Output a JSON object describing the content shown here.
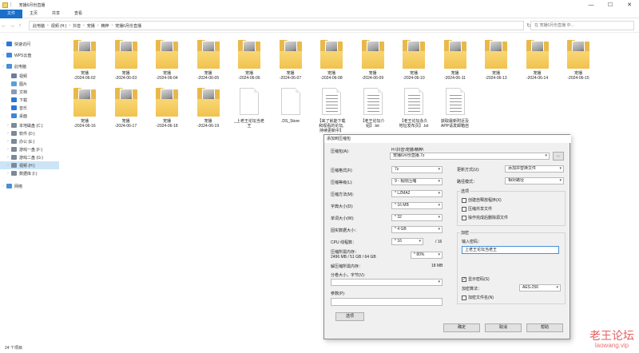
{
  "window": {
    "title": "宠播6月份直播",
    "minimize": "—",
    "maximize": "☐",
    "close": "✕"
  },
  "ribbon": {
    "tabs": [
      "文件",
      "主页",
      "共享",
      "查看"
    ]
  },
  "address": {
    "crumbs": [
      "此电脑",
      "视频 (H:)",
      "抖音",
      "宠播",
      "精粹",
      "宠播6月份直播"
    ],
    "search_placeholder": "在 宠播6月份直播 中..."
  },
  "sidebar": {
    "items": [
      {
        "label": "快速访问",
        "icon": "star-icon",
        "color": "#2b78d4"
      },
      {
        "label": "WPS云盘",
        "icon": "cloud-icon",
        "color": "#3a86e0"
      },
      {
        "label": "此电脑",
        "icon": "computer-icon",
        "color": "#4a8fd8"
      },
      {
        "label": "视频",
        "icon": "video-folder-icon",
        "color": "#6a7f99"
      },
      {
        "label": "图片",
        "icon": "pictures-icon",
        "color": "#5aa0d8"
      },
      {
        "label": "文档",
        "icon": "documents-icon",
        "color": "#8a9bb0"
      },
      {
        "label": "下载",
        "icon": "download-icon",
        "color": "#2b78d4"
      },
      {
        "label": "音乐",
        "icon": "music-icon",
        "color": "#2b78d4"
      },
      {
        "label": "桌面",
        "icon": "desktop-icon",
        "color": "#3a86e0"
      },
      {
        "label": "本地磁盘 (C:)",
        "icon": "drive-icon",
        "color": "#7a8a9a"
      },
      {
        "label": "软件 (D:)",
        "icon": "drive-icon",
        "color": "#7a8a9a"
      },
      {
        "label": "办公 (E:)",
        "icon": "drive-icon",
        "color": "#7a8a9a"
      },
      {
        "label": "游戏一盘 (F:)",
        "icon": "drive-icon",
        "color": "#7a8a9a"
      },
      {
        "label": "游戏二盘 (G:)",
        "icon": "drive-icon",
        "color": "#7a8a9a"
      },
      {
        "label": "视频 (H:)",
        "icon": "drive-icon",
        "color": "#7a8a9a"
      },
      {
        "label": "数据库 (I:)",
        "icon": "drive-icon",
        "color": "#7a8a9a"
      },
      {
        "label": "网络",
        "icon": "network-icon",
        "color": "#4a8fd8"
      }
    ]
  },
  "files": [
    {
      "name": "宠播\n-2024-06-02",
      "type": "folder"
    },
    {
      "name": "宠播\n-2024-06-03",
      "type": "folder"
    },
    {
      "name": "宠播\n-2024-06-04",
      "type": "folder"
    },
    {
      "name": "宠播\n-2024-06-05",
      "type": "folder"
    },
    {
      "name": "宠播\n-2024-06-06",
      "type": "folder"
    },
    {
      "name": "宠播\n-2024-06-07",
      "type": "folder"
    },
    {
      "name": "宠播\n-2024-06-08",
      "type": "folder"
    },
    {
      "name": "宠播\n-2024-06-09",
      "type": "folder"
    },
    {
      "name": "宠播\n-2024-06-10",
      "type": "folder"
    },
    {
      "name": "宠播\n-2024-06-11",
      "type": "folder"
    },
    {
      "name": "宠播\n-2024-06-13",
      "type": "folder"
    },
    {
      "name": "宠播\n-2024-06-14",
      "type": "folder"
    },
    {
      "name": "宠播\n-2024-06-15",
      "type": "folder"
    },
    {
      "name": "宠播\n-2024-06-16",
      "type": "folder"
    },
    {
      "name": "宠播\n-2024-06-17",
      "type": "folder"
    },
    {
      "name": "宠播\n-2024-06-18",
      "type": "folder"
    },
    {
      "name": "宠播\n-2024-06-19",
      "type": "folder"
    },
    {
      "name": "_上老王论坛当老\n王",
      "type": "doc"
    },
    {
      "name": ".DS_Store",
      "type": "doc"
    },
    {
      "name": "【来了就能下载\n和观看的论坛,\n持续更新中】",
      "type": "doc"
    },
    {
      "name": "【老王论坛介\n绍】.txt",
      "type": "doc"
    },
    {
      "name": "【老王论坛永久\n地址发布页】.txt",
      "type": "doc"
    },
    {
      "name": "获取最新附近及\nAPP请发邮箱自",
      "type": "doc"
    }
  ],
  "status": {
    "count_text": "24 个项目"
  },
  "dialog": {
    "title": "添加到压缩包",
    "archive_label": "压缩包(A):",
    "archive_path": "H:\\抖音\\宠播\\精粹\\",
    "archive_name": "宠播6月份直播.7z",
    "browse_label": "...",
    "format_label": "压缩格式(F):",
    "format_value": "7z",
    "level_label": "压缩等级(L):",
    "level_value": "9 - 极限压缩",
    "method_label": "压缩方法(M):",
    "method_value": "* LZMA2",
    "dict_label": "字典大小(D):",
    "dict_value": "* 16 MB",
    "word_label": "单词大小(W):",
    "word_value": "* 32",
    "solid_label": "固实数据大小：",
    "solid_value": "* 4 GB",
    "cpu_label": "CPU 线程数：",
    "cpu_value": "* 16",
    "cpu_total": "/ 16",
    "mem_label": "压缩所需内存：",
    "mem_detail": "2496 MB / 51 GB / 64 GB",
    "mem_percent": "* 80%",
    "decomp_label": "解压缩所需内存：",
    "decomp_value": "18 MB",
    "split_label": "分卷大小，字节(V):",
    "params_label": "参数(P):",
    "options_btn": "选项",
    "update_label": "更新方式(U):",
    "update_value": "添加并替换文件",
    "path_label": "路径模式：",
    "path_value": "相对路径",
    "options_group": "选项",
    "opt_sfx": "创建自释放程序(X)",
    "opt_shared": "压缩共享文件",
    "opt_delete": "操作完成后删除源文件",
    "encrypt_group": "加密",
    "password_label": "输入密码：",
    "password_value": "上老王论坛当老王",
    "show_password": "显示密码(S)",
    "enc_method_label": "加密算法：",
    "enc_method_value": "AES-256",
    "encrypt_names": "加密文件名(N)",
    "ok": "确定",
    "cancel": "取消",
    "help": "帮助"
  },
  "watermark": {
    "main": "老王论坛",
    "sub": "laowang.vip"
  }
}
